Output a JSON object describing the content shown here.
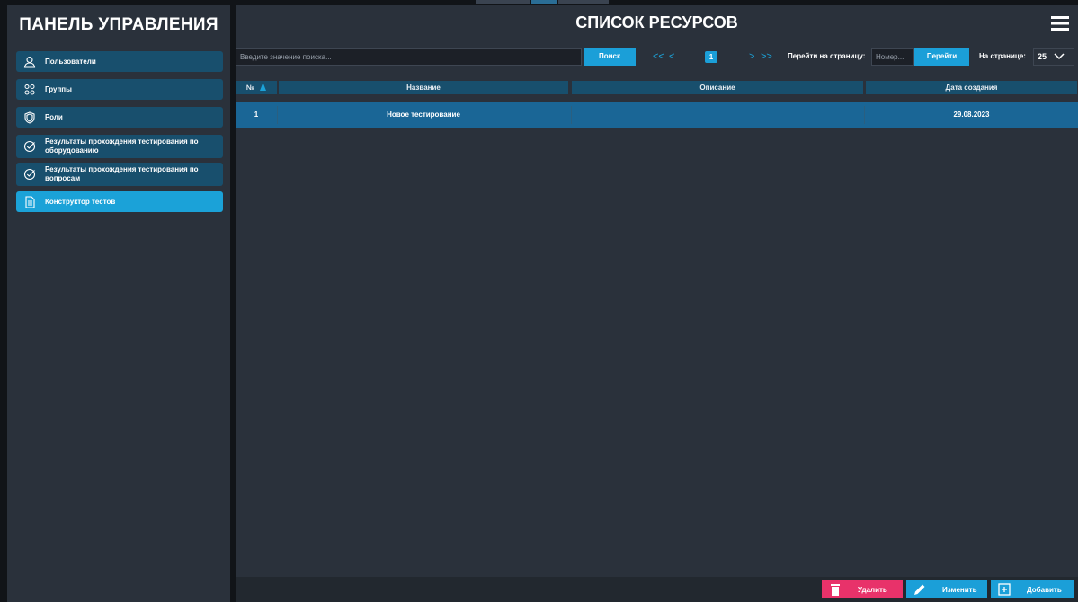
{
  "sidebar": {
    "title": "ПАНЕЛЬ УПРАВЛЕНИЯ",
    "items": [
      {
        "label": "Пользователи",
        "icon": "user-icon"
      },
      {
        "label": "Группы",
        "icon": "users-icon"
      },
      {
        "label": "Роли",
        "icon": "shield-icon"
      },
      {
        "label": "Результаты прохождения тестирования по оборудованию",
        "icon": "check-badge-icon"
      },
      {
        "label": "Результаты прохождения тестирования по вопросам",
        "icon": "check-badge-icon"
      },
      {
        "label": "Конструктор тестов",
        "icon": "document-icon",
        "active": true
      }
    ]
  },
  "header": {
    "title": "СПИСОК РЕСУРСОВ"
  },
  "search": {
    "placeholder": "Введите значение поиска...",
    "button": "Поиск"
  },
  "pagination": {
    "first": "<<",
    "prev": "<",
    "current": "1",
    "next": ">",
    "last": ">>",
    "goto_label": "Перейти на страницу:",
    "goto_placeholder": "Номер...",
    "goto_button": "Перейти",
    "per_page_label": "На странице:",
    "per_page_value": "25"
  },
  "table": {
    "columns": [
      "№",
      "Название",
      "Описание",
      "Дата создания"
    ],
    "sort_column": "№",
    "rows": [
      {
        "num": "1",
        "name": "Новое тестирование",
        "description": "",
        "date": "29.08.2023"
      }
    ]
  },
  "actions": {
    "delete": "Удалить",
    "edit": "Изменить",
    "add": "Добавить"
  },
  "colors": {
    "accent": "#1ba2d8",
    "nav_item": "#184f6d",
    "panel": "#2a313b",
    "background": "#111418",
    "row_selected": "#1a6696",
    "danger": "#e8326a"
  }
}
